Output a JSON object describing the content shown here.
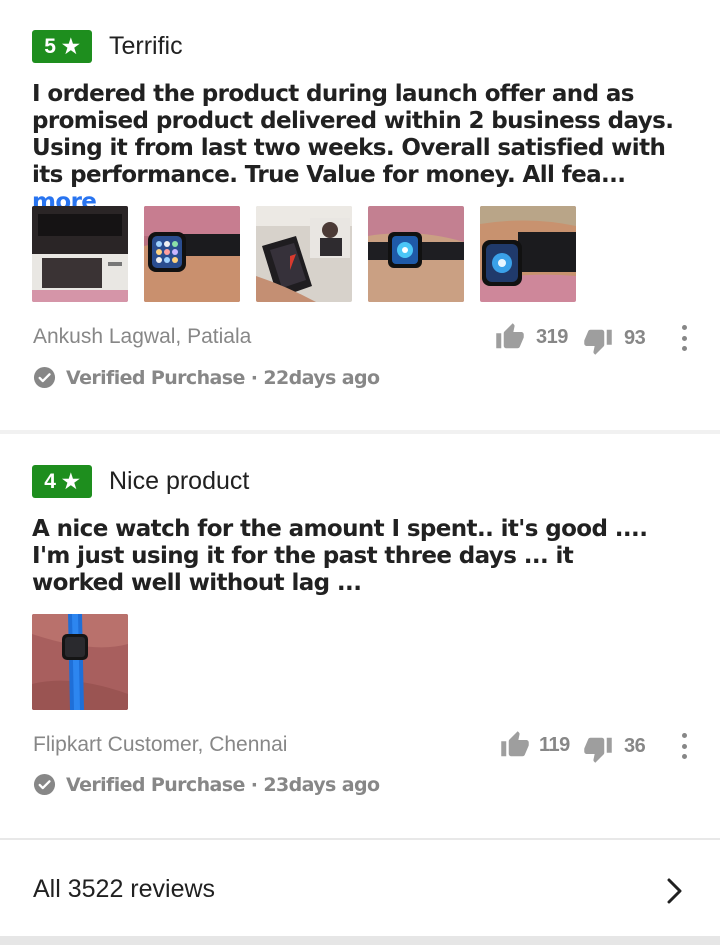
{
  "reviews": [
    {
      "rating": "5",
      "title": "Terrific",
      "text": "I ordered the product during launch offer and as promised product delivered within 2 business days. Using it from last two weeks. Overall satisfied with its performance.  True Value for money. All fea...",
      "more_label": "more",
      "images": [
        "watch-box-photo",
        "watch-on-hand-photo",
        "watch-in-box-photo",
        "watch-on-palm-photo",
        "watch-on-wrist-photo"
      ],
      "author": "Ankush Lagwal, Patiala",
      "upvotes": "319",
      "downvotes": "93",
      "verified": "Verified Purchase · 22days ago"
    },
    {
      "rating": "4",
      "title": "Nice product",
      "text": "A nice watch for the amount I spent.. it's good .... I'm just using it for the past three days ... it worked well without lag ...",
      "images": [
        "blue-strap-watch-photo"
      ],
      "author": "Flipkart Customer, Chennai",
      "upvotes": "119",
      "downvotes": "36",
      "verified": "Verified Purchase · 23days ago"
    }
  ],
  "footer": {
    "all_reviews_label": "All 3522 reviews"
  },
  "colors": {
    "rating_green": "#1e8e1e",
    "link_blue": "#2874f0",
    "muted_grey": "#878787",
    "text_dark": "#212121"
  },
  "icons": {
    "star": "star-icon",
    "thumbs_up": "thumbs-up-icon",
    "thumbs_down": "thumbs-down-icon",
    "more_options": "more-options-icon",
    "verified": "verified-check-icon",
    "chevron": "chevron-right-icon"
  }
}
